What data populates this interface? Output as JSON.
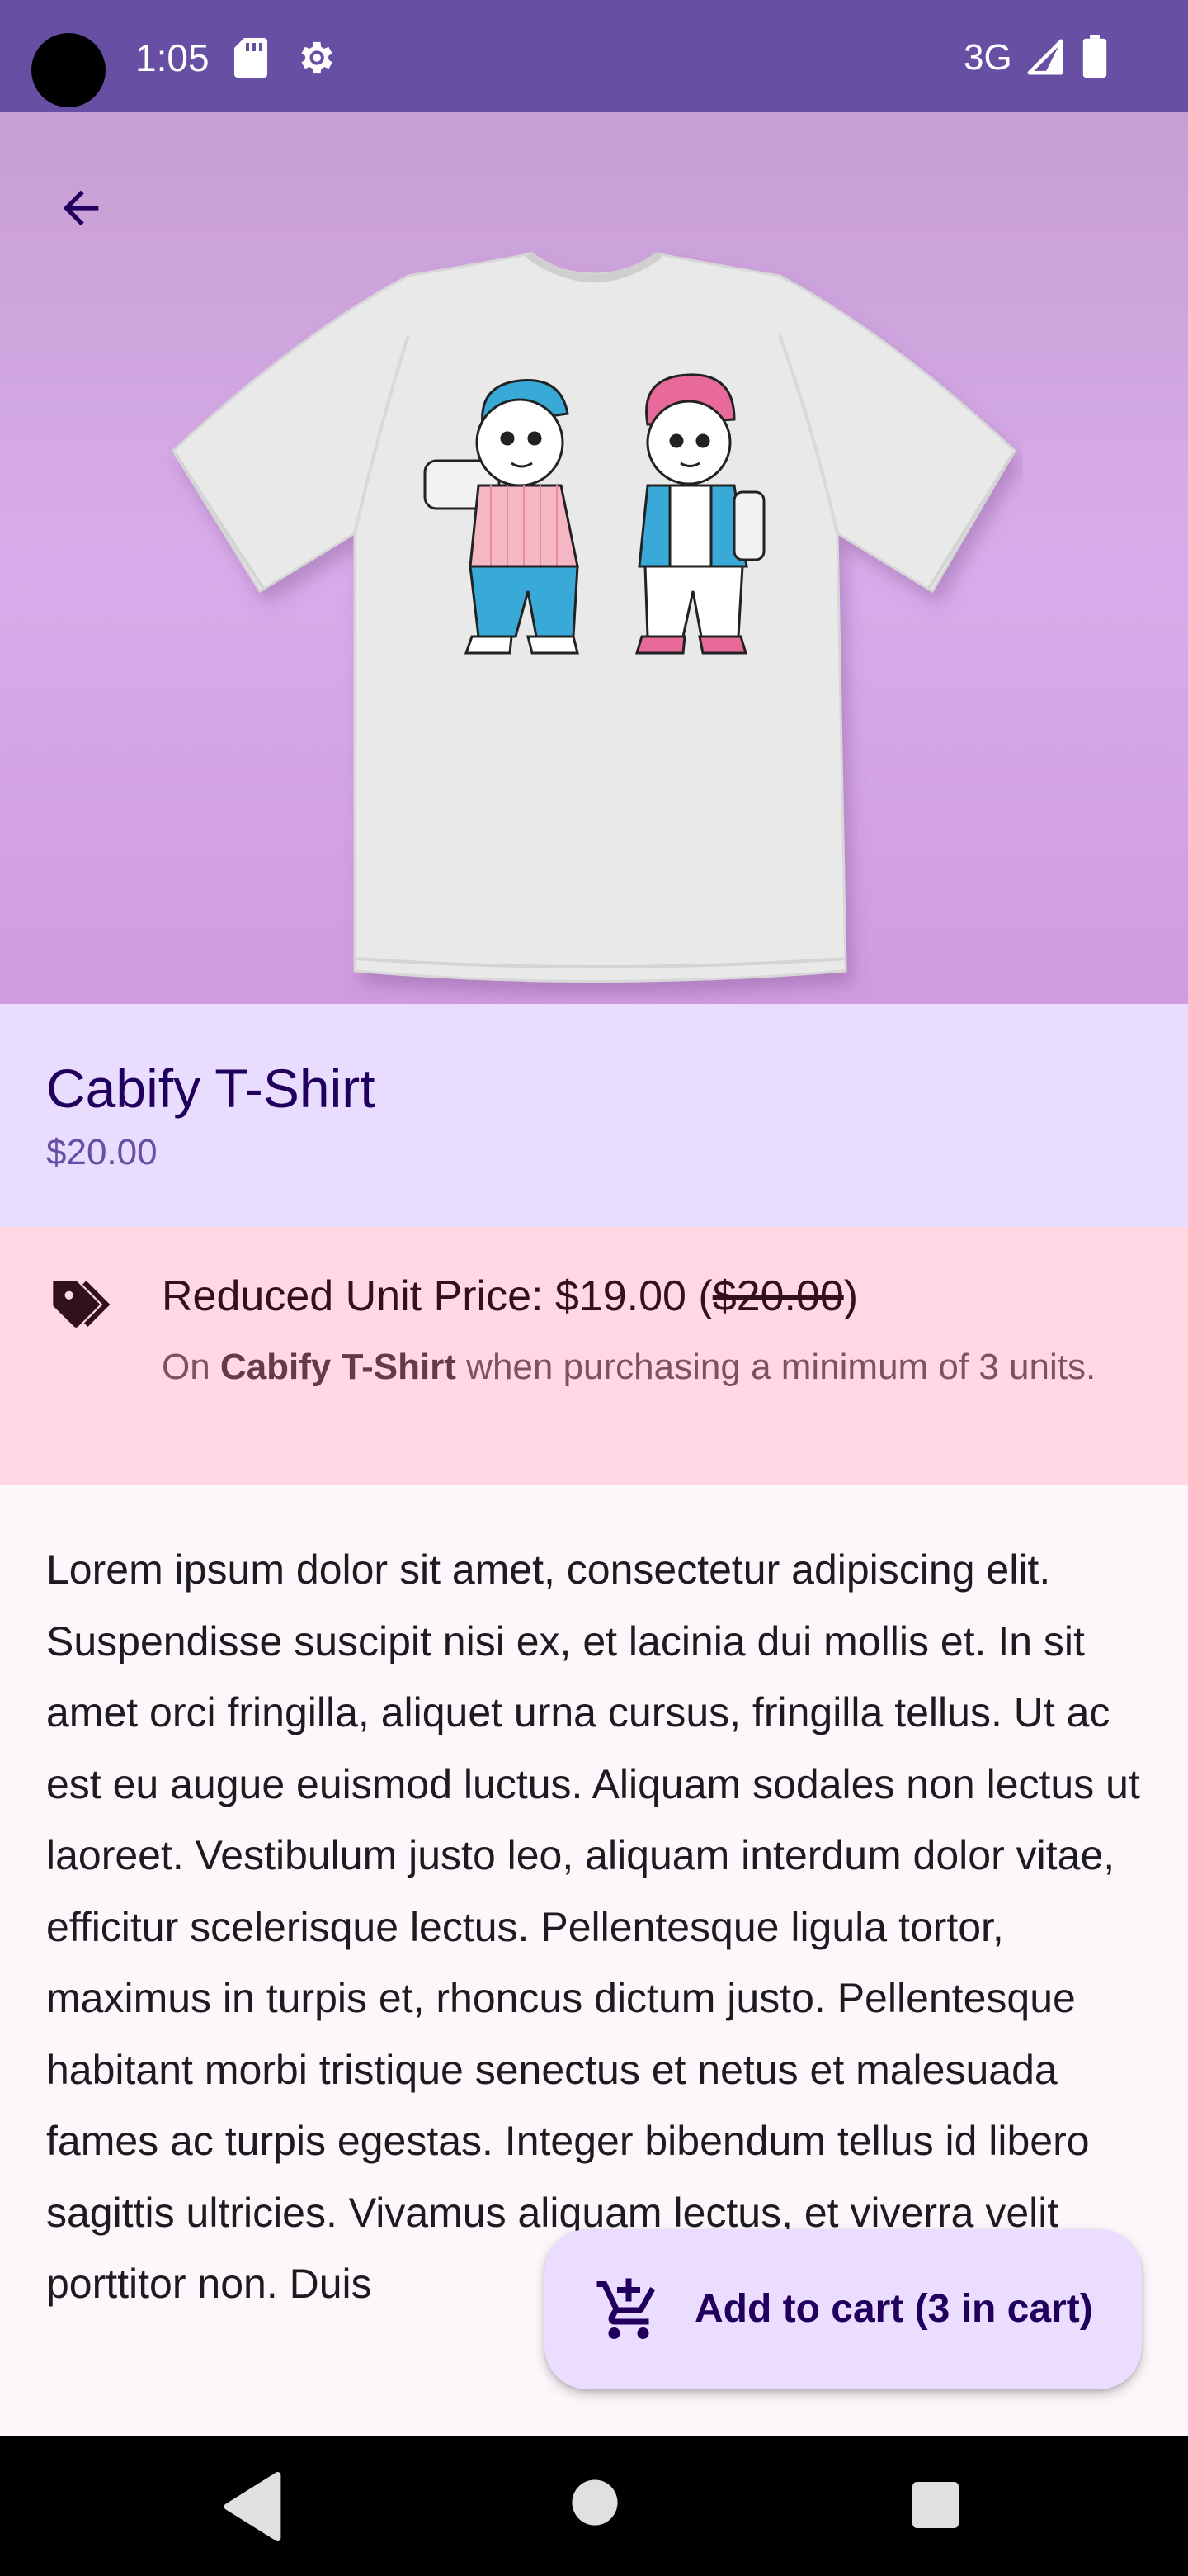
{
  "status_bar": {
    "time": "1:05",
    "network": "3G",
    "icons": [
      "sd-card-icon",
      "gear-icon",
      "signal-icon",
      "battery-icon"
    ]
  },
  "hero": {
    "back_icon": "arrow-left-icon",
    "image": "t-shirt-with-two-cartoon-characters"
  },
  "product": {
    "name": "Cabify T-Shirt",
    "price": "$20.00"
  },
  "promo": {
    "icon": "tag-icon",
    "title_prefix": "Reduced Unit Price: $19.00 (",
    "title_strike": "$20.00",
    "title_suffix": ")",
    "desc_prefix": "On ",
    "desc_product": "Cabify T-Shirt",
    "desc_suffix": " when purchasing a minimum of 3 units."
  },
  "description": "Lorem ipsum dolor sit amet, consectetur adipiscing elit. Suspendisse suscipit nisi ex, et lacinia dui mollis et. In sit amet orci fringilla, aliquet urna cursus, fringilla tellus. Ut ac est eu augue euismod luctus. Aliquam sodales non lectus ut laoreet. Vestibulum justo leo, aliquam interdum dolor vitae, efficitur scelerisque lectus. Pellentesque ligula tortor, maximus in turpis et, rhoncus dictum justo. Pellentesque habitant morbi tristique senectus et netus et malesuada fames ac turpis egestas. Integer bibendum tellus id libero sagittis ultricies. Vivamus aliquam lectus, et viverra velit porttitor non. Duis",
  "fab": {
    "icon": "add-shopping-cart-icon",
    "label": "Add to cart (3 in cart)"
  },
  "nav_bar": {
    "icons": [
      "nav-back-icon",
      "nav-home-icon",
      "nav-recents-icon"
    ]
  },
  "colors": {
    "status_bar": "#6750a4",
    "title_bg": "#e9ddff",
    "title_text": "#21005d",
    "price_text": "#6750a4",
    "promo_bg": "#ffd8e4",
    "promo_title": "#31111d",
    "promo_desc": "#7d5260",
    "fab_bg": "#eaddff"
  }
}
